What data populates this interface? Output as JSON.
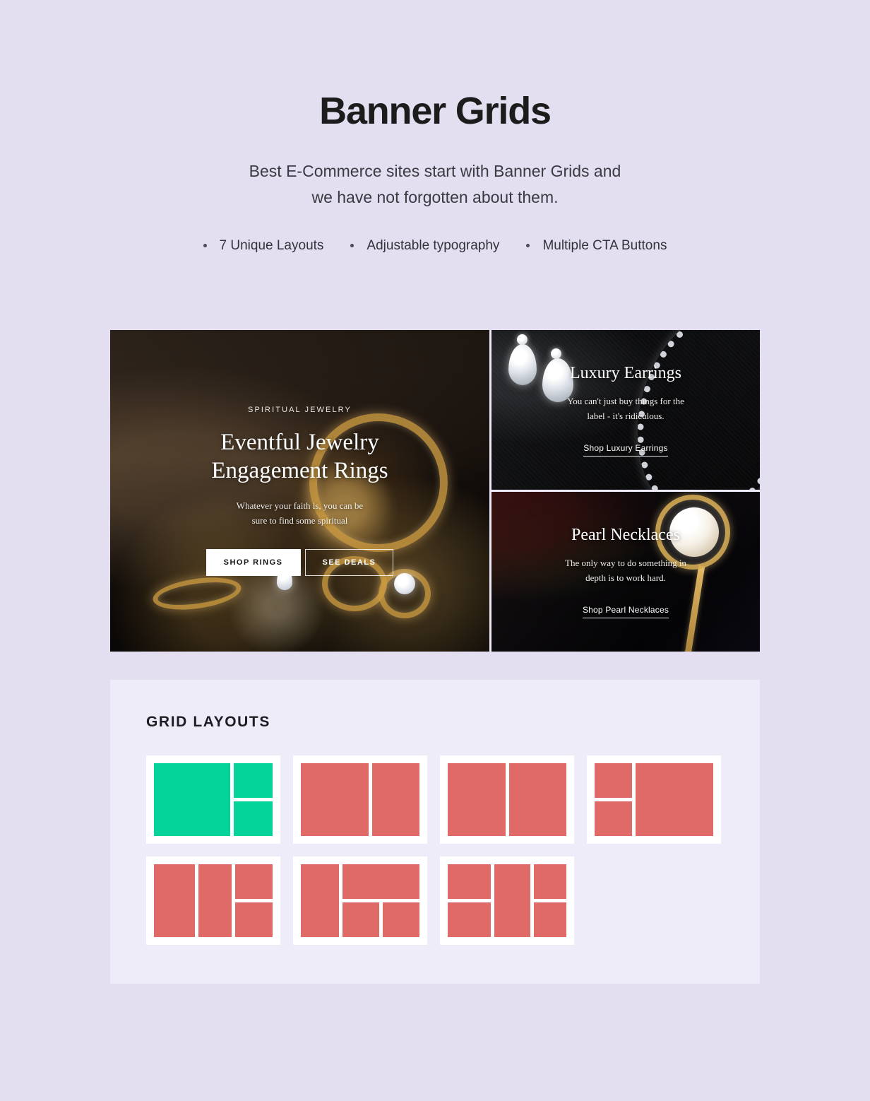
{
  "hero": {
    "title": "Banner Grids",
    "subtitle_line1": "Best E-Commerce sites start with Banner Grids and",
    "subtitle_line2": "we have not forgotten about them.",
    "features": [
      "7 Unique Layouts",
      "Adjustable typography",
      "Multiple CTA Buttons"
    ]
  },
  "banners": {
    "main": {
      "eyebrow": "SPIRITUAL JEWELRY",
      "title_line1": "Eventful Jewelry",
      "title_line2": "Engagement Rings",
      "description_line1": "Whatever your faith is, you can be",
      "description_line2": "sure to find some spiritual",
      "primary_cta": "SHOP RINGS",
      "secondary_cta": "SEE DEALS"
    },
    "top_right": {
      "title": "Luxury Earrings",
      "description_line1": "You can't just buy things for the",
      "description_line2": "label - it's ridiculous.",
      "link_cta": "Shop Luxury Earrings"
    },
    "bottom_right": {
      "title": "Pearl Necklaces",
      "description_line1": "The only way to do something in",
      "description_line2": "depth is to work hard.",
      "link_cta": "Shop Pearl Necklaces"
    }
  },
  "layouts_section": {
    "title": "GRID LAYOUTS",
    "active_index": 0,
    "active_color": "#04d39a",
    "inactive_color": "#df6a68",
    "thumbnails": [
      {
        "name": "layout-1",
        "structure": "large-left + two-stacked-right",
        "active": true
      },
      {
        "name": "layout-2",
        "structure": "wide-left + narrow-right"
      },
      {
        "name": "layout-3",
        "structure": "two-equal-columns"
      },
      {
        "name": "layout-4",
        "structure": "two-stacked-left + large-right"
      },
      {
        "name": "layout-5",
        "structure": "two-columns + split-third-column"
      },
      {
        "name": "layout-6",
        "structure": "tall-left + wide-top-and-two-bottom-right"
      },
      {
        "name": "layout-7",
        "structure": "split-left + tall-center + split-right"
      }
    ]
  },
  "colors": {
    "page_background": "#e3dff0",
    "panel_background": "#efecf9",
    "heading": "#1c1c1c",
    "body_text": "#3a3a42"
  }
}
